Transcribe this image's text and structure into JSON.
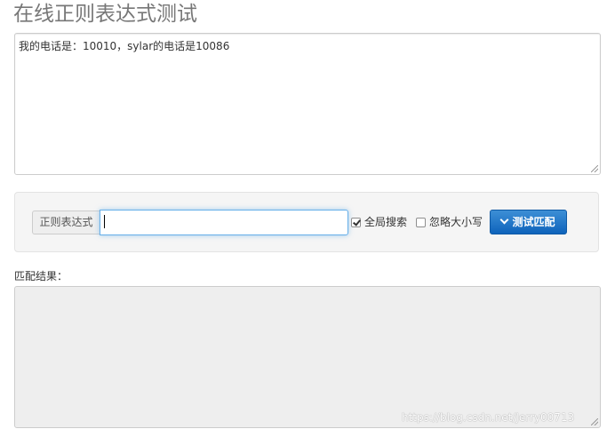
{
  "page": {
    "title": "在线正则表达式测试"
  },
  "source": {
    "text": "我的电话是：10010，sylar的电话是10086"
  },
  "controls": {
    "regex_label": "正则表达式",
    "regex_value": "",
    "global_search": {
      "label": "全局搜索",
      "checked": true
    },
    "ignore_case": {
      "label": "忽略大小写",
      "checked": false
    },
    "match_button": {
      "label": "测试匹配",
      "icon": "chevron-down-icon"
    }
  },
  "result": {
    "label": "匹配结果：",
    "text": ""
  },
  "watermark": {
    "text": "https://blog.csdn.net/Jerry00713"
  },
  "colors": {
    "button_bg": "#1a6fc4",
    "panel_bg": "#f5f5f5",
    "result_bg": "#eeeeee",
    "input_focus": "#66afe9"
  }
}
